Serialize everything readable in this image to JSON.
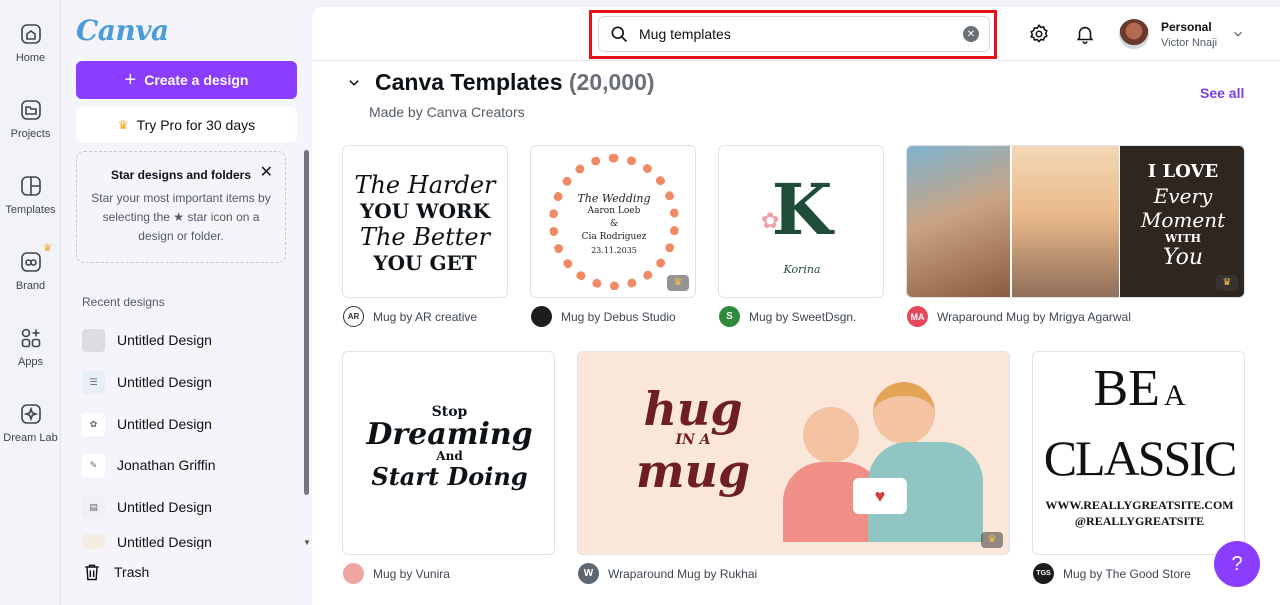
{
  "rail": {
    "home": "Home",
    "projects": "Projects",
    "templates": "Templates",
    "brand": "Brand",
    "apps": "Apps",
    "dreamlab": "Dream Lab"
  },
  "panel": {
    "logo": "Canva",
    "create_label": "Create a design",
    "pro_label": "Try Pro for 30 days",
    "star_title": "Star designs and folders",
    "star_text": "Star your most important items by selecting the ★ star icon on a design or folder.",
    "recent_heading": "Recent designs",
    "recent": [
      {
        "label": "Untitled Design"
      },
      {
        "label": "Untitled Design"
      },
      {
        "label": "Untitled Design"
      },
      {
        "label": "Jonathan Griffin"
      },
      {
        "label": "Untitled Design"
      },
      {
        "label": "Untitled Design"
      }
    ],
    "trash_label": "Trash"
  },
  "topbar": {
    "search_value": "Mug templates",
    "account_type": "Personal",
    "account_name": "Victor Nnaji"
  },
  "section": {
    "title": "Canva Templates",
    "count": "(20,000)",
    "subtitle": "Made by Canva Creators",
    "see_all": "See all"
  },
  "templates": [
    {
      "art": [
        "The Harder",
        "YOU WORK",
        "The Better",
        "YOU GET"
      ],
      "creator": "Mug by AR creative",
      "avatar": "AR"
    },
    {
      "art": [
        "The Wedding",
        "Aaron Loeb",
        "&",
        "Cia Rodriguez",
        "23.11.2035"
      ],
      "creator": "Mug by Debus Studio",
      "avatar": ""
    },
    {
      "art": [
        "K",
        "Korina"
      ],
      "creator": "Mug by SweetDsgn.",
      "avatar": "S"
    },
    {
      "art": [
        "I LOVE",
        "Every",
        "Moment",
        "WITH",
        "You"
      ],
      "creator": "Wraparound Mug by Mrigya Agarwal",
      "avatar": "MA"
    },
    {
      "art": [
        "Stop",
        "Dreaming",
        "And",
        "Start Doing"
      ],
      "creator": "Mug by Vunira",
      "avatar": ""
    },
    {
      "art": [
        "hug",
        "IN A",
        "mug"
      ],
      "creator": "Wraparound Mug by Rukhai",
      "avatar": "W"
    },
    {
      "art": [
        "BE",
        "A",
        "CLASSIC",
        "WWW.REALLYGREATSITE.COM",
        "@REALLYGREATSITE"
      ],
      "creator": "Mug by The Good Store",
      "avatar": "TGS"
    }
  ],
  "help_label": "?",
  "colors": {
    "accent": "#8b3dff",
    "link": "#7b3fe4",
    "highlight": "#e4131a"
  }
}
